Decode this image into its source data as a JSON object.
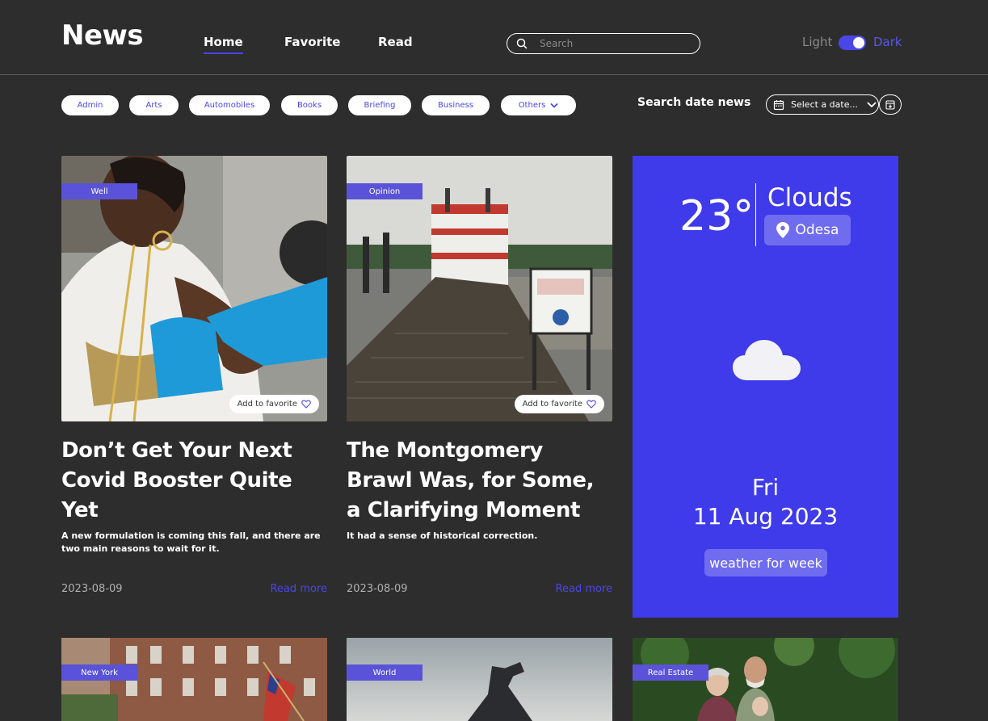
{
  "header": {
    "logo": "News",
    "nav": {
      "home": "Home",
      "favorite": "Favorite",
      "read": "Read"
    },
    "search_placeholder": "Search",
    "theme": {
      "light": "Light",
      "dark": "Dark",
      "active": "dark"
    }
  },
  "filters": {
    "chips": [
      "Admin",
      "Arts",
      "Automobiles",
      "Books",
      "Briefing",
      "Business",
      "Others"
    ],
    "date_label": "Search date news",
    "date_placeholder": "Select a date..."
  },
  "cards": [
    {
      "tag": "Well",
      "favorite_label": "Add to favorite",
      "title": "Don’t Get Your Next Covid Booster Quite Yet",
      "description": "A new formulation is coming this fall, and there are two main reasons to wait for it.",
      "date": "2023-08-09",
      "read_more": "Read more"
    },
    {
      "tag": "Opinion",
      "favorite_label": "Add to favorite",
      "title": "The Montgomery Brawl Was, for Some, a Clarifying Moment",
      "description": "It had a sense of historical correction.",
      "date": "2023-08-09",
      "read_more": "Read more"
    }
  ],
  "weather": {
    "temperature": "23°",
    "condition": "Clouds",
    "city": "Odesa",
    "day": "Fri",
    "date": "11 Aug 2023",
    "week_button": "weather for week"
  },
  "bottom_cards": [
    {
      "tag": "New York"
    },
    {
      "tag": "World"
    },
    {
      "tag": "Real Estate"
    }
  ],
  "colors": {
    "background": "#2d2d2d",
    "accent": "#4a46e8",
    "weather_bg": "#3f3bea",
    "tag_bg": "#5a53d9"
  }
}
